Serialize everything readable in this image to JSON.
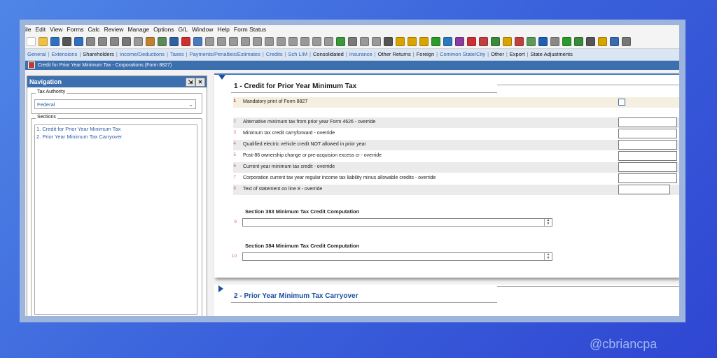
{
  "menu": [
    "File",
    "Edit",
    "View",
    "Forms",
    "Calc",
    "Review",
    "Manage",
    "Options",
    "G/L",
    "Window",
    "Help",
    "Form Status"
  ],
  "menu_display": [
    "ile",
    "Edit",
    "View",
    "Forms",
    "Calc",
    "Review",
    "Manage",
    "Options",
    "G/L",
    "Window",
    "Help",
    "Form Status"
  ],
  "tabs": [
    {
      "label": "General",
      "style": "link"
    },
    {
      "label": "Extensions",
      "style": "link"
    },
    {
      "label": "Shareholders",
      "style": "dark"
    },
    {
      "label": "Income/Deductions",
      "style": "link"
    },
    {
      "label": "Taxes",
      "style": "link"
    },
    {
      "label": "Payments/Penalties/Estimates",
      "style": "link"
    },
    {
      "label": "Credits",
      "style": "link"
    },
    {
      "label": "Sch L/M",
      "style": "link"
    },
    {
      "label": "Consolidated",
      "style": "dark"
    },
    {
      "label": "Insurance",
      "style": "link"
    },
    {
      "label": "Other Returns",
      "style": "dark"
    },
    {
      "label": "Foreign",
      "style": "dark"
    },
    {
      "label": "Common State/City",
      "style": "link"
    },
    {
      "label": "Other",
      "style": "dark"
    },
    {
      "label": "Export",
      "style": "dark"
    },
    {
      "label": "State Adjustments",
      "style": "dark"
    }
  ],
  "title_bar": "Credit for Prior Year Minimum Tax - Corporations (Form 8827)",
  "navigation": {
    "header": "Navigation",
    "tax_authority_label": "Tax Authority",
    "tax_authority_value": "Federal",
    "sections_label": "Sections",
    "sections": [
      "1. Credit for Prior Year Minimum Tax",
      "2. Prior Year Minimum Tax Carryover"
    ]
  },
  "form": {
    "section1_title": "1 - Credit for Prior Year Minimum Tax",
    "section2_title": "2 - Prior Year Minimum Tax Carryover",
    "rows": [
      {
        "num": "1",
        "label": "Mandatory print of Form 8827",
        "type": "checkbox"
      },
      {
        "num": "2",
        "label": "Alternative minimum tax from prior year Form 4626 - override",
        "type": "input"
      },
      {
        "num": "3",
        "label": "Minimum tax credit carryforward - override",
        "type": "input"
      },
      {
        "num": "4",
        "label": "Qualified electric vehicle credit NOT allowed in prior year",
        "type": "input"
      },
      {
        "num": "5",
        "label": "Post-86 ownership change or pre-acquision excess cr - override",
        "type": "input"
      },
      {
        "num": "6",
        "label": "Current year minimum tax credit - override",
        "type": "input"
      },
      {
        "num": "7",
        "label": "Corporation current tax year regular income tax liability minus allowable credits - override",
        "type": "input"
      },
      {
        "num": "8",
        "label": "Text of statement on line 8 - override",
        "type": "input"
      }
    ],
    "section383_title": "Section 383 Minimum Tax Credit Computation",
    "section383_num": "9",
    "section384_title": "Section 384 Minimum Tax Credit Computation",
    "section384_num": "10"
  },
  "watermark": "@cbriancpa",
  "colors": {
    "accent": "#3c6fae",
    "tab_bg": "#dbe6f5",
    "link": "#2e5eaa",
    "background_gradient_start": "#4f86e6",
    "background_gradient_end": "#2f46d2"
  }
}
